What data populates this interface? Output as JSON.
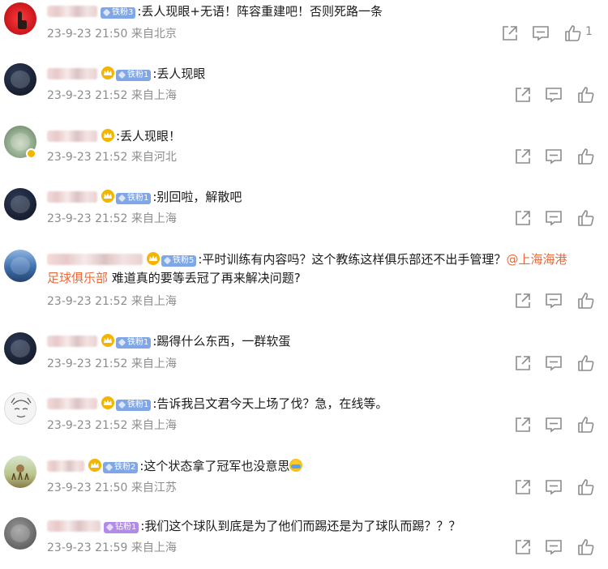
{
  "comments": [
    {
      "badge": "铁粉3",
      "text": ":丢人现眼+无语！阵容重建吧！否则死路一条",
      "meta": "23-9-23 21:50 来自北京",
      "likes": "1"
    },
    {
      "badge": "铁粉1",
      "text": ":丢人现眼",
      "meta": "23-9-23 21:52 来自上海"
    },
    {
      "badge": "",
      "text": ":丢人现眼！",
      "meta": "23-9-23 21:52 来自河北"
    },
    {
      "badge": "铁粉1",
      "text": ":别回啦，解散吧",
      "meta": "23-9-23 21:52 来自上海"
    },
    {
      "badge": "铁粉5",
      "text": ":平时训练有内容吗？这个教练这样俱乐部还不出手管理？",
      "mention": "@上海海港足球俱乐部",
      "mention_part1": "@上海海港",
      "mention_part2": "足球俱乐部",
      "text2": " 难道真的要等丢冠了再来解决问题?",
      "meta": "23-9-23 21:52 来自上海"
    },
    {
      "badge": "铁粉1",
      "text": ":踢得什么东西，一群软蛋",
      "meta": "23-9-23 21:52 来自上海"
    },
    {
      "badge": "铁粉1",
      "text": ":告诉我吕文君今天上场了伐？急，在线等。",
      "meta": "23-9-23 21:52 来自上海"
    },
    {
      "badge": "铁粉2",
      "text": ":这个状态拿了冠军也没意思",
      "meta": "23-9-23 21:50 来自江苏"
    },
    {
      "badge": "钻粉1",
      "text": ":我们这个球队到底是为了他们而踢还是为了球队而踢？？？",
      "meta": "23-9-23 21:59 来自上海"
    }
  ],
  "icons": {
    "share": "share-icon",
    "reply": "comment-icon",
    "like": "thumbs-up-icon"
  },
  "colors": {
    "mention": "#e86a3a",
    "meta": "#8c8c8c",
    "badge_blue": "#7fa7e8",
    "badge_purple": "#b08ce8"
  }
}
